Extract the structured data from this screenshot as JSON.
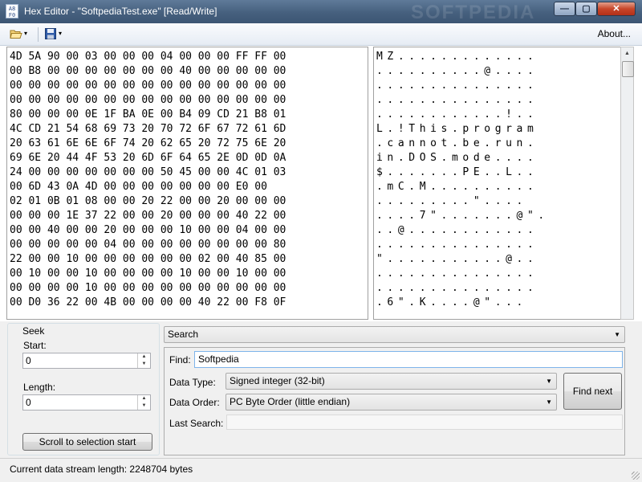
{
  "window": {
    "app_icon_text": "A8 F0",
    "title": "Hex Editor - \"SoftpediaTest.exe\" [Read/Write]",
    "watermark": "SOFTPEDIA"
  },
  "window_buttons": {
    "minimize": "—",
    "maximize": "▢",
    "close": "✕"
  },
  "toolbar": {
    "open_icon": "open-folder-icon",
    "save_icon": "save-disk-icon",
    "dropdown_glyph": "▾",
    "about_label": "About..."
  },
  "hex_rows": [
    "4D 5A 90 00 03 00 00 00 04 00 00 00 FF FF 00",
    "00 B8 00 00 00 00 00 00 00 40 00 00 00 00 00",
    "00 00 00 00 00 00 00 00 00 00 00 00 00 00 00",
    "00 00 00 00 00 00 00 00 00 00 00 00 00 00 00",
    "80 00 00 00 0E 1F BA 0E 00 B4 09 CD 21 B8 01",
    "4C CD 21 54 68 69 73 20 70 72 6F 67 72 61 6D",
    "20 63 61 6E 6E 6F 74 20 62 65 20 72 75 6E 20",
    "69 6E 20 44 4F 53 20 6D 6F 64 65 2E 0D 0D 0A",
    "24 00 00 00 00 00 00 00 50 45 00 00 4C 01 03",
    "00 6D 43 0A 4D 00 00 00 00 00 00 00 E0 00",
    "02 01 0B 01 08 00 00 20 22 00 00 20 00 00 00",
    "00 00 00 1E 37 22 00 00 20 00 00 00 40 22 00",
    "00 00 40 00 00 20 00 00 00 10 00 00 04 00 00",
    "00 00 00 00 00 04 00 00 00 00 00 00 00 00 80",
    "22 00 00 10 00 00 00 00 00 00 02 00 40 85 00",
    "00 10 00 00 10 00 00 00 00 10 00 00 10 00 00",
    "00 00 00 00 10 00 00 00 00 00 00 00 00 00 00",
    "00 D0 36 22 00 4B 00 00 00 00 40 22 00 F8 0F"
  ],
  "ascii_rows": [
    "MZ.............",
    "..........@....",
    "...............",
    "...............",
    "............!..",
    "L.!This.program",
    ".cannot.be.run.",
    "in.DOS.mode....",
    "$.......PE..L..",
    ".mC.M..........",
    ".........\"....",
    "....7\".......@\".",
    "..@............",
    "...............",
    "\"...........@..",
    "...............",
    "...............",
    ".6\".K....@\"..."
  ],
  "scrollbar": {
    "up_glyph": "▲"
  },
  "seek": {
    "legend": "Seek",
    "start_label": "Start:",
    "start_value": "0",
    "length_label": "Length:",
    "length_value": "0",
    "scroll_button": "Scroll to selection start",
    "spin_up": "▲",
    "spin_down": "▼"
  },
  "search": {
    "header": "Search",
    "find_label": "Find:",
    "find_value": "Softpedia",
    "data_type_label": "Data Type:",
    "data_type_value": "Signed integer (32-bit)",
    "data_order_label": "Data Order:",
    "data_order_value": "PC Byte Order (little endian)",
    "find_next_label": "Find next",
    "last_search_label": "Last Search:",
    "last_search_value": "",
    "dropdown_glyph": "▼"
  },
  "status": {
    "text": "Current data stream length: 2248704 bytes"
  }
}
